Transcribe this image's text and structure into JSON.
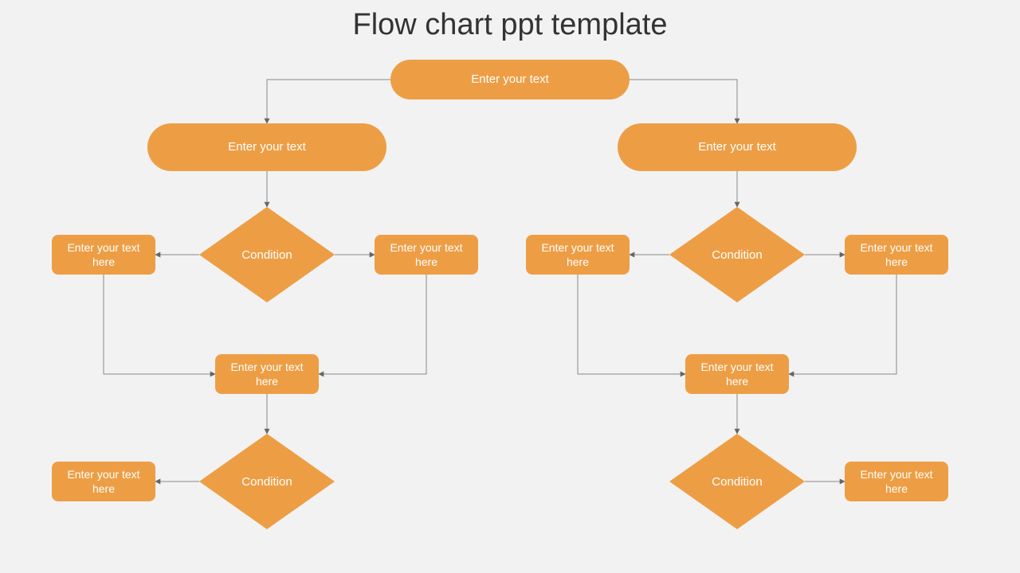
{
  "title": "Flow chart ppt template",
  "colors": {
    "accent": "#ed9e45",
    "bg": "#f2f2f2",
    "title": "#333333"
  },
  "nodes": {
    "top_pill": "Enter your text",
    "left_pill": "Enter your text",
    "right_pill": "Enter your text",
    "left_cond1": "Condition",
    "right_cond1": "Condition",
    "left_box_tl": "Enter your text here",
    "left_box_tr": "Enter your text here",
    "right_box_tl": "Enter your text here",
    "right_box_tr": "Enter your text here",
    "left_merge": "Enter your text here",
    "right_merge": "Enter your text here",
    "left_cond2": "Condition",
    "right_cond2": "Condition",
    "left_box_bl": "Enter your text here",
    "right_box_br": "Enter your text here"
  },
  "chart_data": {
    "type": "flowchart",
    "nodes": [
      {
        "id": "n0",
        "shape": "terminator",
        "label": "Enter your text"
      },
      {
        "id": "n1",
        "shape": "terminator",
        "label": "Enter your text"
      },
      {
        "id": "n2",
        "shape": "terminator",
        "label": "Enter your text"
      },
      {
        "id": "d1",
        "shape": "decision",
        "label": "Condition"
      },
      {
        "id": "d2",
        "shape": "decision",
        "label": "Condition"
      },
      {
        "id": "p1",
        "shape": "process",
        "label": "Enter your text here"
      },
      {
        "id": "p2",
        "shape": "process",
        "label": "Enter your text here"
      },
      {
        "id": "p3",
        "shape": "process",
        "label": "Enter your text here"
      },
      {
        "id": "p4",
        "shape": "process",
        "label": "Enter your text here"
      },
      {
        "id": "m1",
        "shape": "process",
        "label": "Enter your text here"
      },
      {
        "id": "m2",
        "shape": "process",
        "label": "Enter your text here"
      },
      {
        "id": "d3",
        "shape": "decision",
        "label": "Condition"
      },
      {
        "id": "d4",
        "shape": "decision",
        "label": "Condition"
      },
      {
        "id": "p5",
        "shape": "process",
        "label": "Enter your text here"
      },
      {
        "id": "p6",
        "shape": "process",
        "label": "Enter your text here"
      }
    ],
    "edges": [
      [
        "n0",
        "n1"
      ],
      [
        "n0",
        "n2"
      ],
      [
        "n1",
        "d1"
      ],
      [
        "n2",
        "d2"
      ],
      [
        "d1",
        "p1"
      ],
      [
        "d1",
        "p2"
      ],
      [
        "d2",
        "p3"
      ],
      [
        "d2",
        "p4"
      ],
      [
        "p1",
        "m1"
      ],
      [
        "p2",
        "m1"
      ],
      [
        "p3",
        "m2"
      ],
      [
        "p4",
        "m2"
      ],
      [
        "m1",
        "d3"
      ],
      [
        "m2",
        "d4"
      ],
      [
        "d3",
        "p5"
      ],
      [
        "d4",
        "p6"
      ]
    ]
  }
}
